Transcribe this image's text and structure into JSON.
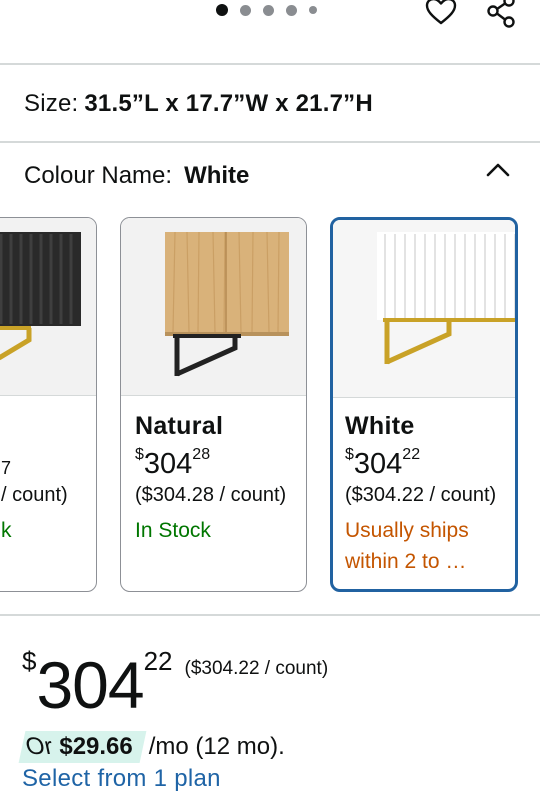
{
  "carousel": {
    "total_dots": 5,
    "active_index": 0
  },
  "icons": {
    "wishlist": "heart-outline-icon",
    "share": "share-icon",
    "collapse": "chevron-up-icon"
  },
  "size": {
    "label": "Size:",
    "value": "31.5”L x 17.7”W x 21.7”H"
  },
  "colour": {
    "label": "Colour Name:",
    "value": "White"
  },
  "variants": [
    {
      "name": "",
      "price_symbol": "",
      "price_whole": "",
      "price_fraction": "",
      "partial_price_tail": "7",
      "unit": "/ count)",
      "availability": "k",
      "availability_type": "in-stock"
    },
    {
      "name": "Natural",
      "price_symbol": "$",
      "price_whole": "304",
      "price_fraction": "28",
      "unit": "($304.28 / count)",
      "availability": "In Stock",
      "availability_type": "in-stock"
    },
    {
      "name": "White",
      "price_symbol": "$",
      "price_whole": "304",
      "price_fraction": "22",
      "unit": "($304.22 / count)",
      "availability": "Usually ships within 2 to …",
      "availability_line1": "Usually ships",
      "availability_line2": "within 2 to …",
      "availability_type": "delayed",
      "selected": true
    }
  ],
  "price": {
    "symbol": "$",
    "whole": "304",
    "fraction": "22",
    "unit": "($304.22 / count)"
  },
  "emi": {
    "prefix": "Or",
    "amount": "$29.66",
    "suffix": "/mo (12 mo)."
  },
  "plan_link": "Select from 1 plan",
  "colors": {
    "link_blue": "#1f64a6",
    "selected_border": "#2162a1",
    "in_stock_green": "#007600",
    "ships_orange": "#c45500",
    "emi_highlight": "#d7f3ec"
  }
}
